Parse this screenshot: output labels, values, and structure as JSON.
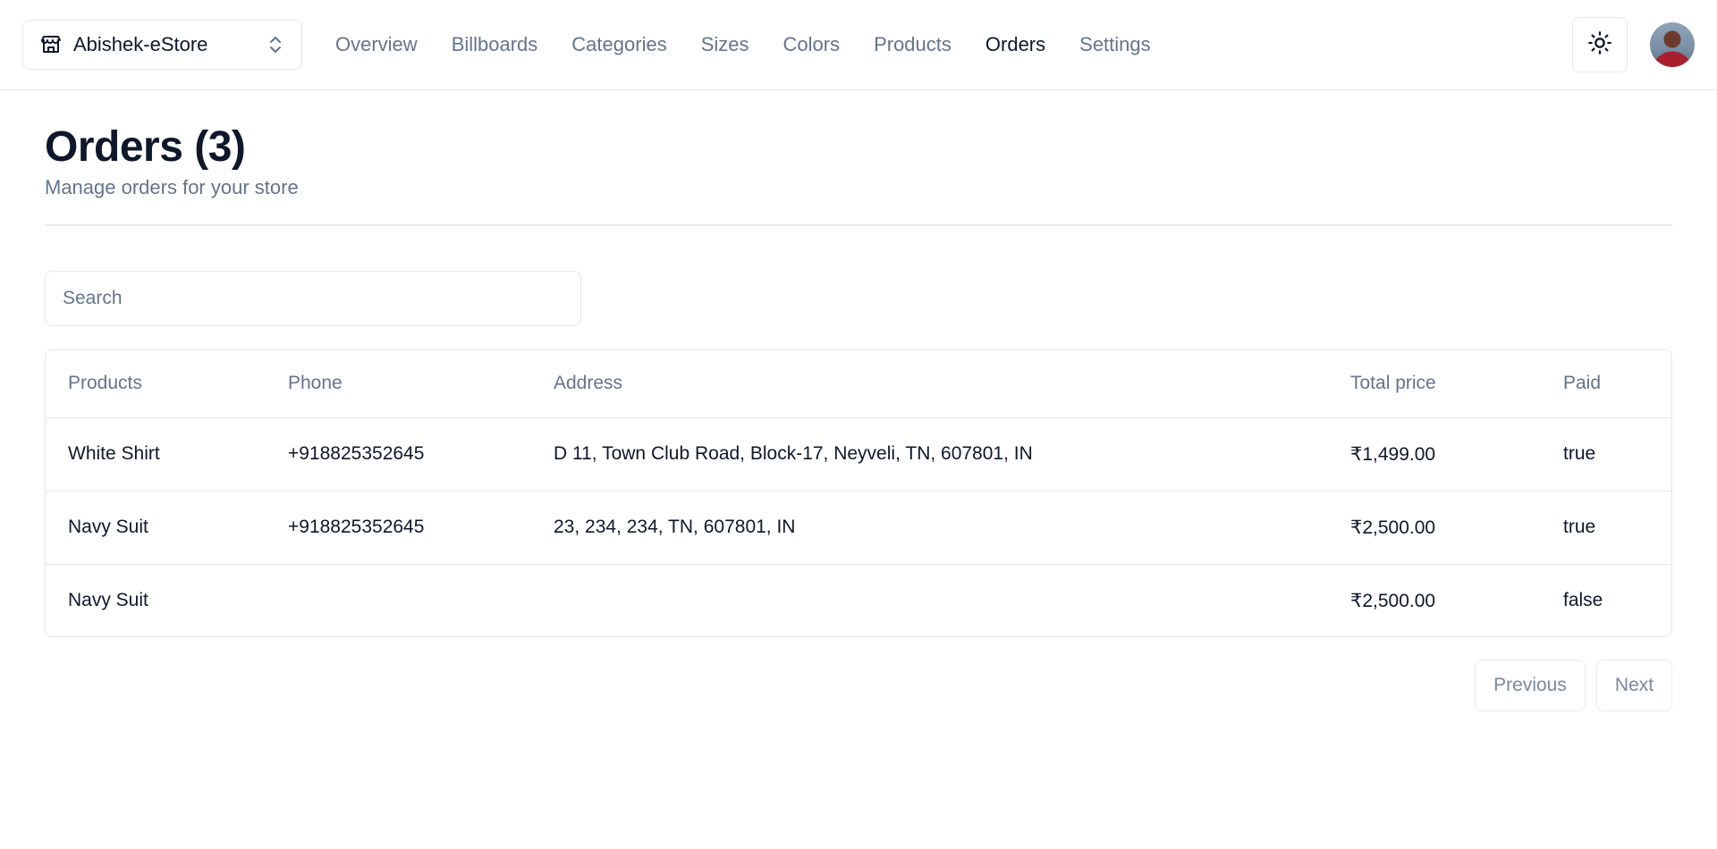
{
  "navbar": {
    "store_name": "Abishek-eStore",
    "links": [
      "Overview",
      "Billboards",
      "Categories",
      "Sizes",
      "Colors",
      "Products",
      "Orders",
      "Settings"
    ],
    "active": "Orders"
  },
  "heading": {
    "title": "Orders (3)",
    "subtitle": "Manage orders for your store"
  },
  "search": {
    "placeholder": "Search",
    "value": ""
  },
  "table": {
    "columns": [
      "Products",
      "Phone",
      "Address",
      "Total price",
      "Paid"
    ],
    "rows": [
      [
        "White Shirt",
        "+918825352645",
        "D 11, Town Club Road, Block-17, Neyveli, TN, 607801, IN",
        "₹1,499.00",
        "true"
      ],
      [
        "Navy Suit",
        "+918825352645",
        "23, 234, 234, TN, 607801, IN",
        "₹2,500.00",
        "true"
      ],
      [
        "Navy Suit",
        "",
        "",
        "₹2,500.00",
        "false"
      ]
    ]
  },
  "pagination": {
    "previous": "Previous",
    "next": "Next"
  },
  "icons": {
    "store": "store-icon",
    "chevrons": "chevrons-up-down-icon",
    "theme": "sun-icon"
  }
}
